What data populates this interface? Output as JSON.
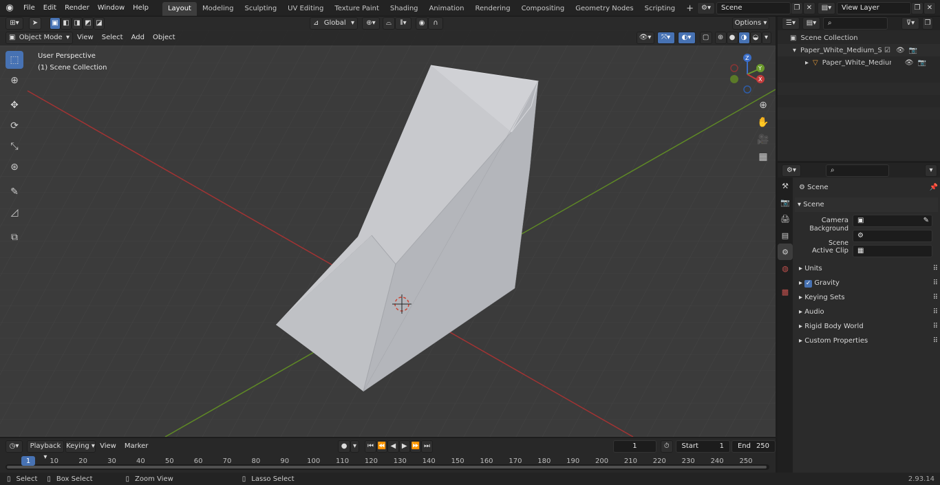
{
  "topbar": {
    "menus": [
      "File",
      "Edit",
      "Render",
      "Window",
      "Help"
    ],
    "workspaces": [
      "Layout",
      "Modeling",
      "Sculpting",
      "UV Editing",
      "Texture Paint",
      "Shading",
      "Animation",
      "Rendering",
      "Compositing",
      "Geometry Nodes",
      "Scripting"
    ],
    "active_workspace": "Layout",
    "add_tab": "+",
    "scene_name": "Scene",
    "view_layer": "View Layer"
  },
  "viewport_header": {
    "mode": "Object Mode",
    "menus": [
      "View",
      "Select",
      "Add",
      "Object"
    ],
    "orientation": "Global",
    "options_label": "Options"
  },
  "viewport": {
    "perspective_label": "User Perspective",
    "collection_label": "(1) Scene Collection",
    "gizmo_axes": [
      "Z",
      "Y",
      "X"
    ]
  },
  "outliner": {
    "root": "Scene Collection",
    "items": [
      {
        "label": "Paper_White_Medium_Sandw"
      },
      {
        "label": "Paper_White_Medium_Sa"
      }
    ]
  },
  "properties": {
    "context_title": "Scene",
    "section_title": "Scene",
    "fields": [
      {
        "label": "Camera",
        "value": ""
      },
      {
        "label": "Background Scene",
        "value": ""
      },
      {
        "label": "Active Clip",
        "value": ""
      }
    ],
    "subpanels": [
      "Units",
      "Gravity",
      "Keying Sets",
      "Audio",
      "Rigid Body World",
      "Custom Properties"
    ],
    "gravity_checked": true
  },
  "timeline": {
    "menus": [
      "Playback",
      "Keying",
      "View",
      "Marker"
    ],
    "current_frame": "1",
    "start_label": "Start",
    "start_value": "1",
    "end_label": "End",
    "end_value": "250",
    "ruler": [
      "1",
      "10",
      "20",
      "30",
      "40",
      "50",
      "60",
      "70",
      "80",
      "90",
      "100",
      "110",
      "120",
      "130",
      "140",
      "150",
      "160",
      "170",
      "180",
      "190",
      "200",
      "210",
      "220",
      "230",
      "240",
      "250"
    ]
  },
  "statusbar": {
    "hints": [
      "Select",
      "Box Select",
      "Zoom View",
      "Lasso Select"
    ],
    "version": "2.93.14"
  },
  "colors": {
    "accent": "#4772b3",
    "x_axis": "#c33b3b",
    "y_axis": "#6b9a2c",
    "grid_bg": "#3b3b3b"
  }
}
